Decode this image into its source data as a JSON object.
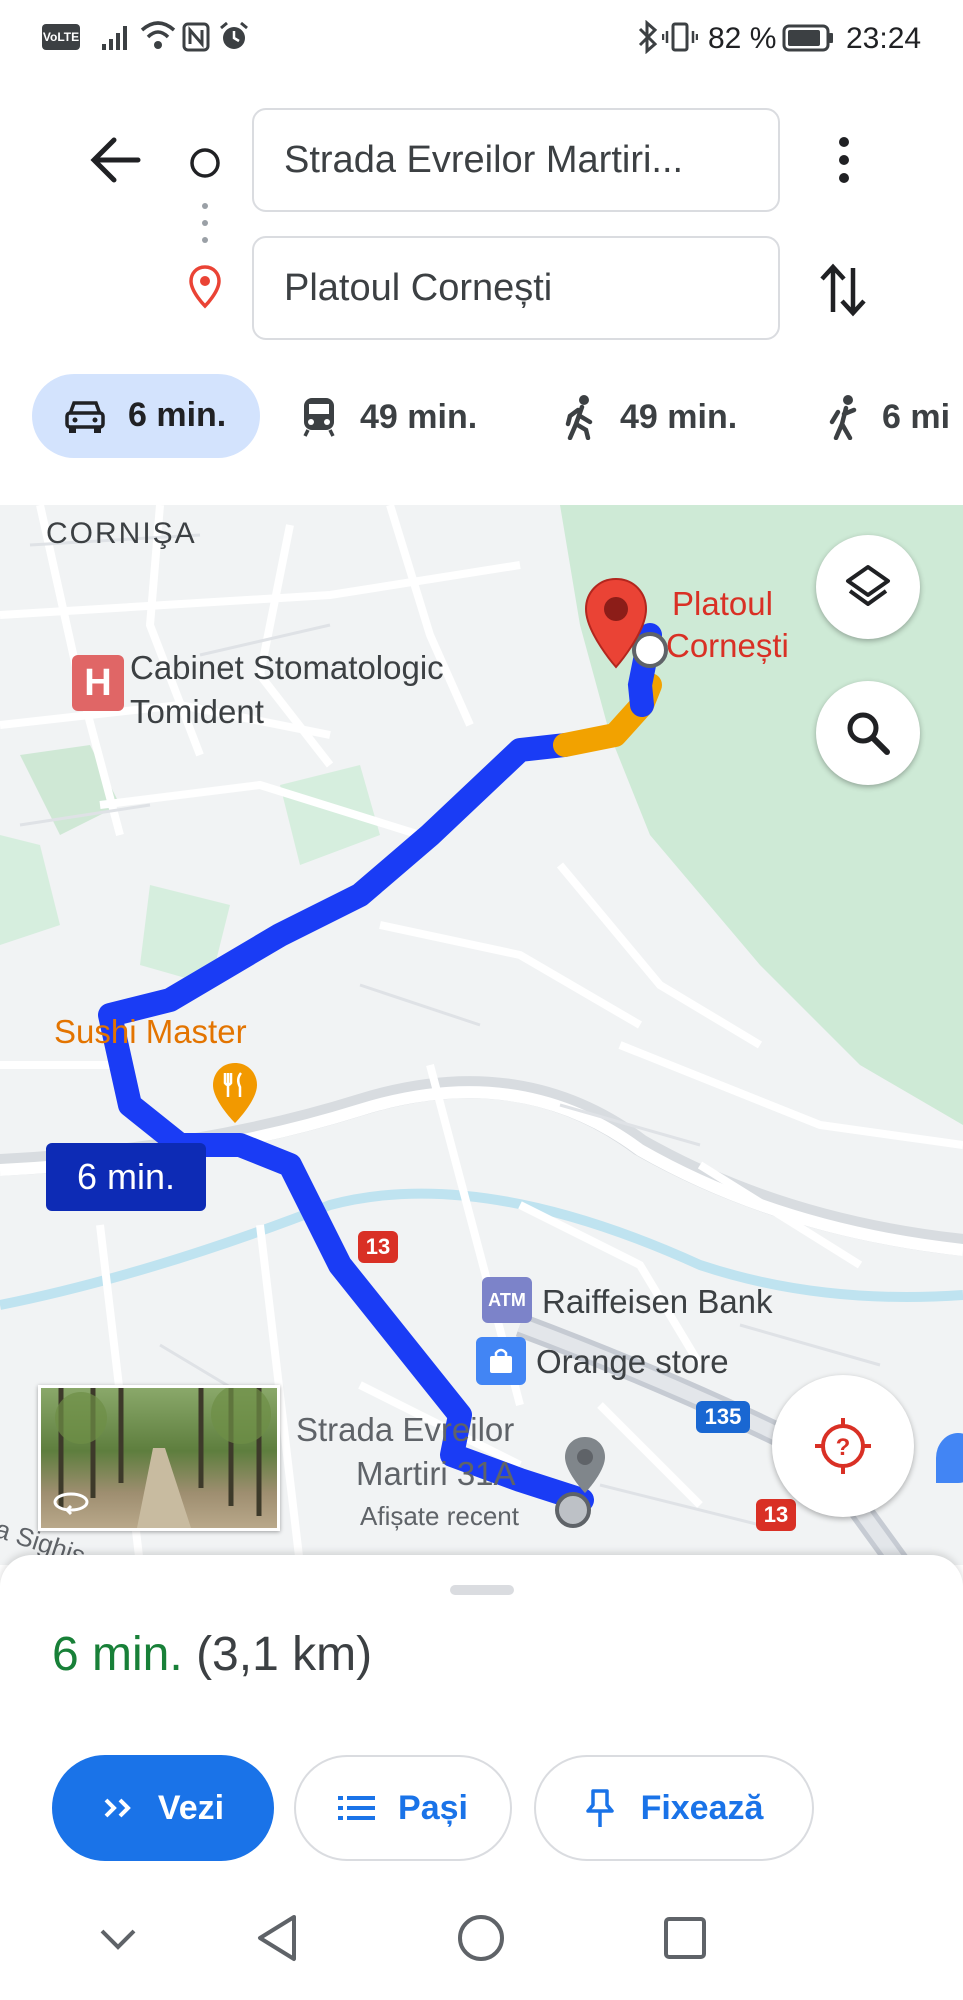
{
  "status_bar": {
    "volte": "VoLTE",
    "battery_percent": "82 %",
    "time": "23:24"
  },
  "directions": {
    "origin": "Strada Evreilor Martiri...",
    "destination": "Platoul Cornești"
  },
  "modes": [
    {
      "icon": "car-icon",
      "label": "6 min.",
      "selected": true
    },
    {
      "icon": "transit-icon",
      "label": "49 min."
    },
    {
      "icon": "walk-icon",
      "label": "49 min."
    },
    {
      "icon": "ride-icon",
      "label": "6 mi"
    }
  ],
  "map": {
    "area_label": "CORNIŞA",
    "place_1": {
      "icon": "hospital-icon",
      "line1": "Cabinet Stomatologic",
      "line2": "Tomident"
    },
    "destination_label": {
      "line1": "Platoul",
      "line2": "Cornești"
    },
    "restaurant": "Sushi Master",
    "route_time": "6 min.",
    "road_13": "13",
    "road_135": "135",
    "road_13b": "13",
    "atm_badge": "ATM",
    "bank": "Raiffeisen Bank",
    "store": "Orange store",
    "origin_label": {
      "line1": "Strada Evreilor",
      "line2": "Martiri 31A",
      "line3": "Afișate recent"
    },
    "edge_text": "a Sighiș",
    "colors": {
      "route": "#1a3cf5",
      "traffic": "#f2a200",
      "destination_pin": "#ea4335",
      "park": "#ceead6"
    }
  },
  "sheet": {
    "duration": "6 min.",
    "distance": "(3,1 km)",
    "buttons": {
      "view": "Vezi",
      "steps": "Pași",
      "pin": "Fixează"
    }
  }
}
